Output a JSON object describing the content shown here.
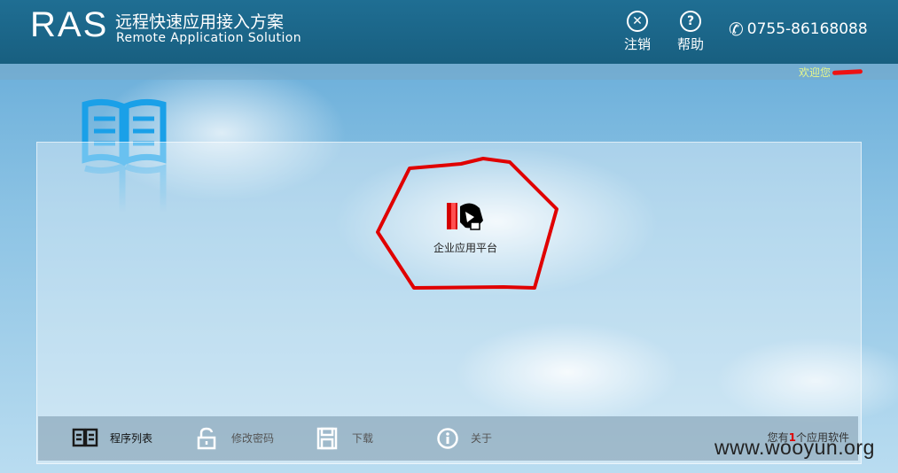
{
  "header": {
    "logo": "RAS",
    "title_cn": "远程快速应用接入方案",
    "title_en": "Remote Application Solution",
    "logout_label": "注销",
    "help_label": "帮助",
    "phone": "0755-86168088"
  },
  "welcome": {
    "text": "欢迎您"
  },
  "apps": [
    {
      "label": "企业应用平台",
      "icon": "enterprise-app-icon"
    }
  ],
  "toolbar": {
    "program_list": "程序列表",
    "change_password": "修改密码",
    "download": "下载",
    "about": "关于",
    "count_prefix": "您有",
    "count_value": "1",
    "count_suffix": "个应用软件"
  },
  "watermark": "www.wooyun.org",
  "colors": {
    "header_bg": "#1d6a8e",
    "welcome_text": "#e8f78a",
    "annotation_red": "#e00000",
    "book_blue": "#1aa0e8"
  }
}
